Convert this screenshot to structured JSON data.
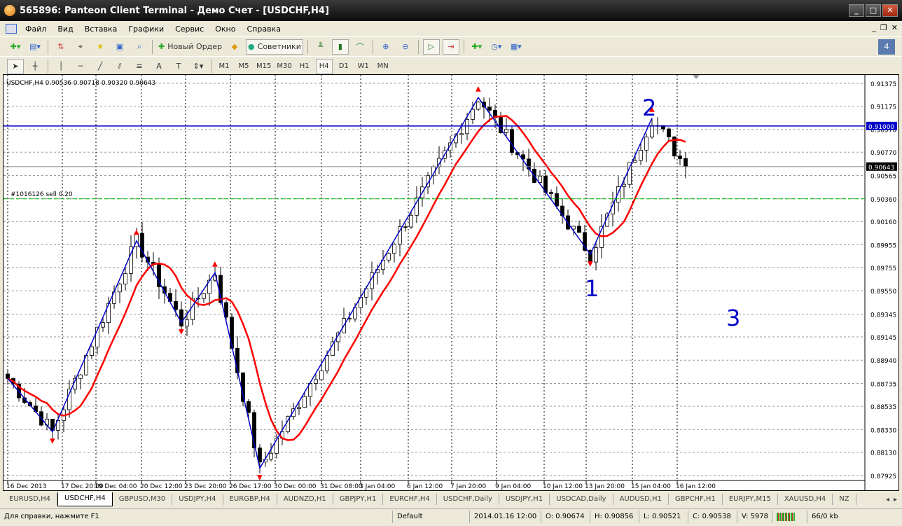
{
  "window": {
    "title": "565896: Panteon Client Terminal - Демо Счет - [USDCHF,H4]"
  },
  "menu": [
    "Файл",
    "Вид",
    "Вставка",
    "Графики",
    "Сервис",
    "Окно",
    "Справка"
  ],
  "toolbar": {
    "new_order": "Новый Ордер",
    "experts": "Советники"
  },
  "timeframes": [
    "M1",
    "M5",
    "M15",
    "M30",
    "H1",
    "H4",
    "D1",
    "W1",
    "MN"
  ],
  "active_timeframe": "H4",
  "drawing_tools": {
    "text": "A"
  },
  "chart": {
    "header": "USDCHF,H4  0.90536 0.90718 0.90320 0.90643",
    "order_label": "#1016126 sell 0.20",
    "wave_labels": [
      "1",
      "2",
      "3"
    ],
    "colors": {
      "bull": "#ffffff",
      "bear": "#000000",
      "ma": "#ff0000",
      "zigzag": "#0000c8",
      "hline": "#0000c8",
      "order": "#00c000",
      "arrows": "#ff0000"
    }
  },
  "chart_data": {
    "type": "candlestick",
    "symbol": "USDCHF",
    "timeframe": "H4",
    "ylim": [
      0.87925,
      0.91375
    ],
    "price_ticks": [
      "0.91375",
      "0.91175",
      "0.90970",
      "0.90770",
      "0.90565",
      "0.90360",
      "0.90160",
      "0.89955",
      "0.89755",
      "0.89550",
      "0.89345",
      "0.89145",
      "0.88940",
      "0.88735",
      "0.88535",
      "0.88330",
      "0.88130",
      "0.87925"
    ],
    "time_ticks": [
      "16 Dec 2013",
      "17 Dec 20:00",
      "19 Dec 04:00",
      "20 Dec 12:00",
      "23 Dec 20:00",
      "26 Dec 17:00",
      "30 Dec 00:00",
      "31 Dec 08:00",
      "3 Jan 04:00",
      "6 Jan 12:00",
      "7 Jan 20:00",
      "9 Jan 04:00",
      "10 Jan 12:00",
      "13 Jan 20:00",
      "15 Jan 04:00",
      "16 Jan 12:00"
    ],
    "zigzag": [
      {
        "bar": 0,
        "price": 0.8878
      },
      {
        "bar": 8,
        "price": 0.8831
      },
      {
        "bar": 23,
        "price": 0.8999
      },
      {
        "bar": 31,
        "price": 0.8927
      },
      {
        "bar": 37,
        "price": 0.8971
      },
      {
        "bar": 45,
        "price": 0.8799
      },
      {
        "bar": 84,
        "price": 0.9125
      },
      {
        "bar": 104,
        "price": 0.8987
      },
      {
        "bar": 115,
        "price": 0.9107
      },
      {
        "bar": 121,
        "price": 0.90643
      }
    ],
    "horizontal_lines": [
      {
        "price": 0.91,
        "label": "0.91000",
        "color": "blue"
      },
      {
        "price": 0.90643,
        "label": "0.90643",
        "color": "gray"
      },
      {
        "price": 0.9036,
        "label": "#1016126 sell 0.20",
        "color": "green"
      }
    ],
    "last_price": "0.90643",
    "ma_period": 8
  },
  "tabs": [
    "EURUSD,H4",
    "USDCHF,H4",
    "GBPUSD,M30",
    "USDJPY,H4",
    "EURGBP,H4",
    "AUDNZD,H1",
    "GBPJPY,H1",
    "EURCHF,H4",
    "USDCHF,Daily",
    "USDJPY,H1",
    "USDCAD,Daily",
    "AUDUSD,H1",
    "GBPCHF,H1",
    "EURJPY,M15",
    "XAUUSD,H4",
    "NZ"
  ],
  "active_tab": "USDCHF,H4",
  "status": {
    "help": "Для справки, нажмите F1",
    "profile": "Default",
    "time": "2014.01.16 12:00",
    "open": "O: 0.90674",
    "high": "H: 0.90856",
    "low": "L: 0.90521",
    "close": "C: 0.90538",
    "volume": "V: 5978",
    "traffic": "66/0 kb"
  }
}
